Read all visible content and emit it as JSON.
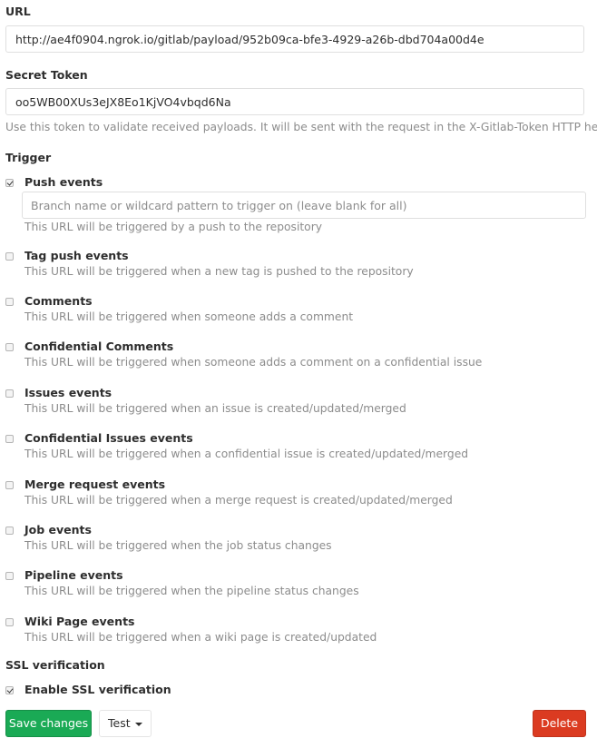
{
  "url": {
    "label": "URL",
    "value": "http://ae4f0904.ngrok.io/gitlab/payload/952b09ca-bfe3-4929-a26b-dbd704a00d4e"
  },
  "secret_token": {
    "label": "Secret Token",
    "value": "oo5WB00XUs3eJX8Eo1KjVO4vbqd6Na",
    "help": "Use this token to validate received payloads. It will be sent with the request in the X-Gitlab-Token HTTP header."
  },
  "trigger": {
    "label": "Trigger",
    "items": [
      {
        "title": "Push events",
        "checked": true,
        "description": "This URL will be triggered by a push to the repository",
        "branch_placeholder": "Branch name or wildcard pattern to trigger on (leave blank for all)"
      },
      {
        "title": "Tag push events",
        "checked": false,
        "description": "This URL will be triggered when a new tag is pushed to the repository"
      },
      {
        "title": "Comments",
        "checked": false,
        "description": "This URL will be triggered when someone adds a comment"
      },
      {
        "title": "Confidential Comments",
        "checked": false,
        "description": "This URL will be triggered when someone adds a comment on a confidential issue"
      },
      {
        "title": "Issues events",
        "checked": false,
        "description": "This URL will be triggered when an issue is created/updated/merged"
      },
      {
        "title": "Confidential Issues events",
        "checked": false,
        "description": "This URL will be triggered when a confidential issue is created/updated/merged"
      },
      {
        "title": "Merge request events",
        "checked": false,
        "description": "This URL will be triggered when a merge request is created/updated/merged"
      },
      {
        "title": "Job events",
        "checked": false,
        "description": "This URL will be triggered when the job status changes"
      },
      {
        "title": "Pipeline events",
        "checked": false,
        "description": "This URL will be triggered when the pipeline status changes"
      },
      {
        "title": "Wiki Page events",
        "checked": false,
        "description": "This URL will be triggered when a wiki page is created/updated"
      }
    ]
  },
  "ssl": {
    "label": "SSL verification",
    "option_label": "Enable SSL verification",
    "checked": true
  },
  "actions": {
    "save_label": "Save changes",
    "test_label": "Test",
    "delete_label": "Delete"
  },
  "colors": {
    "save": "#1aaa55",
    "delete": "#db3b21",
    "muted_text": "#8c8c8c"
  }
}
